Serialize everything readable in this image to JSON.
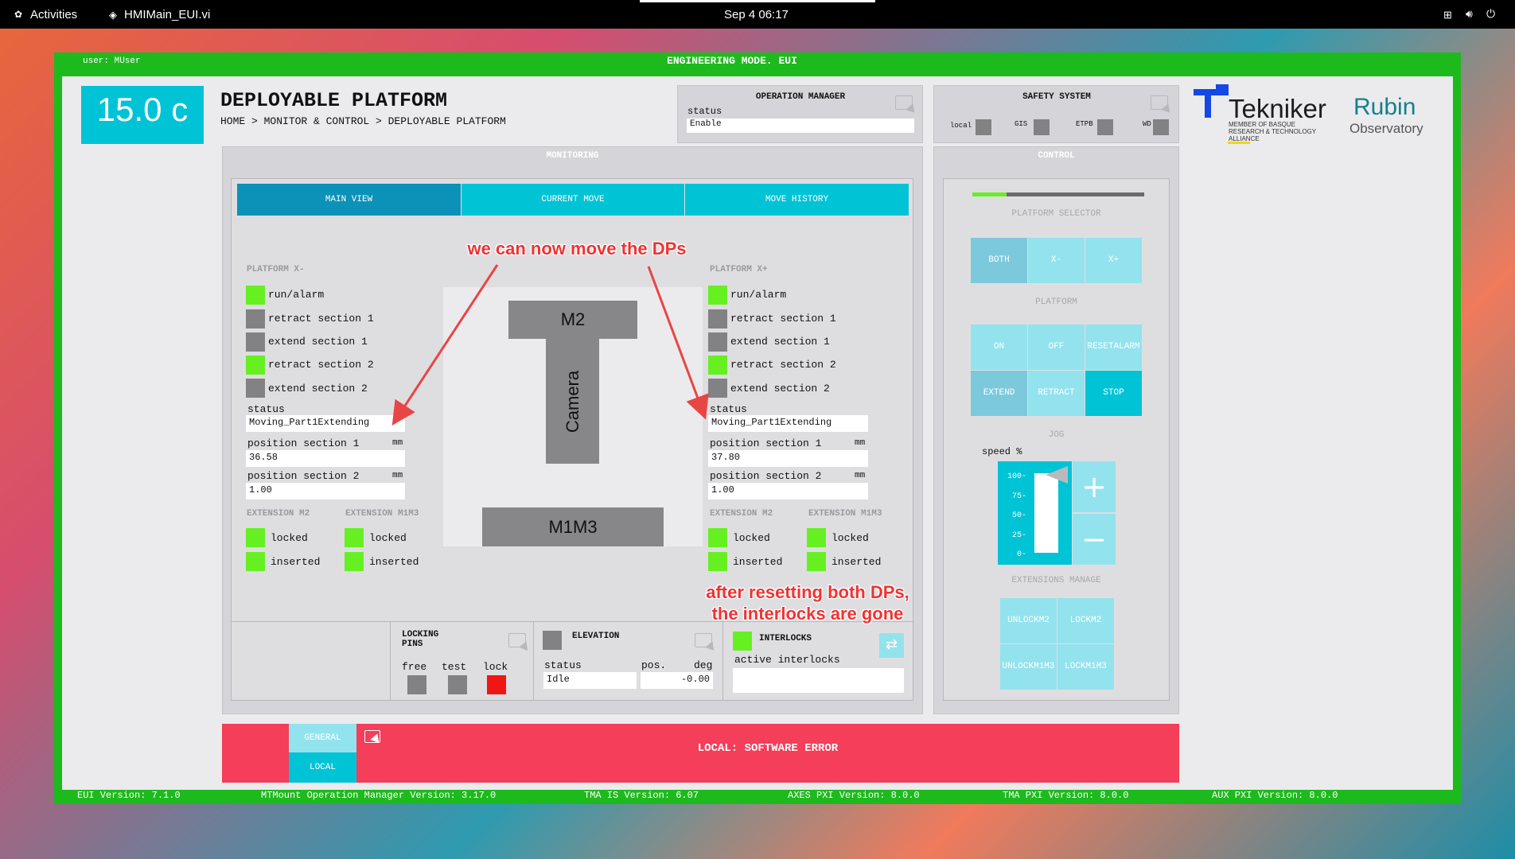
{
  "topbar": {
    "activities": "Activities",
    "app": "HMIMain_EUI.vi",
    "clock": "Sep 4  06:17"
  },
  "header": {
    "user": "user: MUser",
    "mode": "ENGINEERING MODE. EUI",
    "temperature": "15.0 c",
    "title": "DEPLOYABLE PLATFORM",
    "breadcrumb": "HOME > MONITOR & CONTROL > DEPLOYABLE PLATFORM"
  },
  "operation_manager": {
    "title": "OPERATION MANAGER",
    "status_label": "status",
    "status_value": "Enable"
  },
  "safety_system": {
    "title": "SAFETY SYSTEM",
    "items": [
      "local",
      "GIS",
      "ETPB",
      "WD"
    ]
  },
  "logos": {
    "tekniker": "Tekniker",
    "tekniker_sub": "MEMBER OF BASQUE RESEARCH & TECHNOLOGY ALLIANCE",
    "rubin1": "Rubin",
    "rubin2": "Observatory"
  },
  "monitoring": {
    "title": "MONITORING",
    "tabs": [
      "MAIN VIEW",
      "CURRENT MOVE",
      "MOVE HISTORY"
    ],
    "xm": {
      "title": "PLATFORM X-",
      "items": [
        "run/alarm",
        "retract section 1",
        "extend section 1",
        "retract section 2",
        "extend section 2"
      ],
      "status_label": "status",
      "status_value": "Moving_Part1Extending",
      "pos1_label": "position section 1",
      "pos1_value": "36.58",
      "pos2_label": "position section 2",
      "pos2_value": "1.00",
      "unit": "mm",
      "ext_m2": "EXTENSION M2",
      "ext_m1m3": "EXTENSION M1M3",
      "locked": "locked",
      "inserted": "inserted"
    },
    "xp": {
      "title": "PLATFORM X+",
      "items": [
        "run/alarm",
        "retract section 1",
        "extend section 1",
        "retract section 2",
        "extend section 2"
      ],
      "status_label": "status",
      "status_value": "Moving_Part1Extending",
      "pos1_label": "position section 1",
      "pos1_value": "37.80",
      "pos2_label": "position section 2",
      "pos2_value": "1.00",
      "unit": "mm",
      "ext_m2": "EXTENSION M2",
      "ext_m1m3": "EXTENSION M1M3",
      "locked": "locked",
      "inserted": "inserted"
    },
    "diagram": {
      "m2": "M2",
      "camera": "Camera",
      "m1m3": "M1M3"
    },
    "locking_pins": {
      "title1": "LOCKING",
      "title2": "PINS",
      "free": "free",
      "test": "test",
      "lock": "lock"
    },
    "elevation": {
      "title": "ELEVATION",
      "status_label": "status",
      "pos_label": "pos.",
      "unit": "deg",
      "status_value": "Idle",
      "pos_value": "-0.00"
    },
    "interlocks": {
      "title": "INTERLOCKS",
      "active_label": "active interlocks",
      "value": ""
    }
  },
  "control": {
    "title": "CONTROL",
    "progress": 0.2,
    "platform_selector": "PLATFORM SELECTOR",
    "selector_buttons": [
      "BOTH",
      "X-",
      "X+"
    ],
    "platform": "PLATFORM",
    "on": "ON",
    "off": "OFF",
    "reset1": "RESET",
    "reset2": "ALARM",
    "extend": "EXTEND",
    "retract": "RETRACT",
    "stop": "STOP",
    "jog": "JOG",
    "speed_label": "speed %",
    "speed_ticks": [
      "100-",
      "75-",
      "50-",
      "25-",
      "0-"
    ],
    "speed_value_percent": 100,
    "plus": "+",
    "minus": "−",
    "extensions_manage": "EXTENSIONS MANAGE",
    "unlock_m2_1": "UNLOCK",
    "unlock_m2_2": "M2",
    "lock_m2_1": "LOCK",
    "lock_m2_2": "M2",
    "unlock_m1m3_1": "UNLOCK",
    "unlock_m1m3_2": "M1M3",
    "lock_m1m3_1": "LOCK",
    "lock_m1m3_2": "M1M3"
  },
  "alarm_bar": {
    "general": "GENERAL",
    "local": "LOCAL",
    "message": "LOCAL: SOFTWARE ERROR"
  },
  "footer": {
    "eui": "EUI Version: 7.1.0",
    "mtmount": "MTMount Operation Manager Version: 3.17.0",
    "tma_is": "TMA IS Version: 6.07",
    "axes": "AXES PXI Version: 8.0.0",
    "tma_pxi": "TMA PXI Version: 8.0.0",
    "aux": "AUX PXI Version: 8.0.0"
  },
  "annotations": {
    "a1": "we can now move the DPs",
    "a2_line1": "after resetting both DPs,",
    "a2_line2": "the interlocks are gone"
  },
  "colors": {
    "green": "#66f022",
    "gray": "#828284",
    "red": "#f21515",
    "cyan": "#00c3d6",
    "dark_cyan": "#0c91b8",
    "alarm": "#f43e5a",
    "frame": "#1dba1d"
  }
}
